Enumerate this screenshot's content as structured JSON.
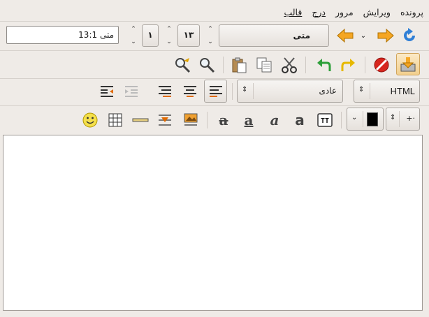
{
  "menu": {
    "file": "پرونده",
    "edit": "ویرایش",
    "view": "مرور",
    "insert": "درج",
    "format": "قالب"
  },
  "toolbar_nav": {
    "location_value": "متی 13:1",
    "chapter_value": "۱۳",
    "verse_value": "۱",
    "book_value": "متی"
  },
  "toolbar_format": {
    "paragraph_style": "عادی",
    "mode": "HTML"
  },
  "colors": {
    "arrow_orange": "#f5a623",
    "stop_red": "#d7261e",
    "refresh_blue": "#2f7fd6",
    "undo_green": "#2e9f3a",
    "redo_yellow": "#e6b800",
    "smiley_yellow": "#f5e04a"
  }
}
